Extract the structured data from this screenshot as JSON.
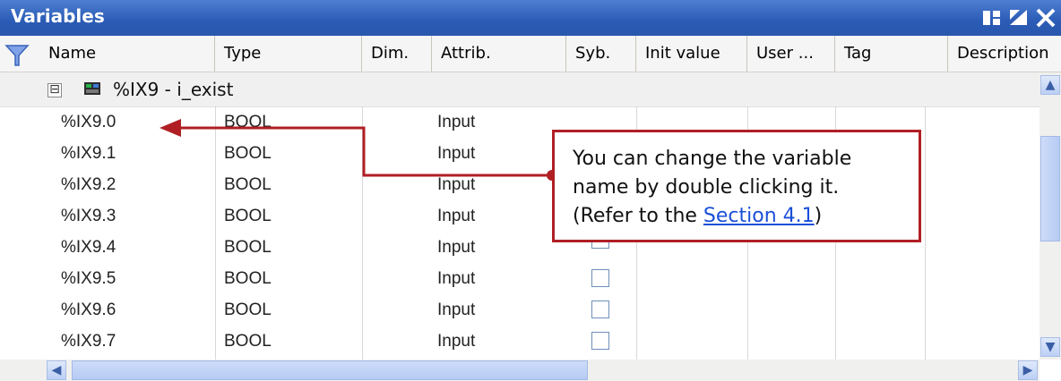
{
  "window": {
    "title": "Variables",
    "buttons": [
      "restore",
      "minimize",
      "close"
    ]
  },
  "columns": [
    "Name",
    "Type",
    "Dim.",
    "Attrib.",
    "Syb.",
    "Init value",
    "User ...",
    "Tag",
    "Description"
  ],
  "group": {
    "label": "%IX9 - i_exist",
    "expanded_symbol": "⊟"
  },
  "rows": [
    {
      "name": "%IX9.0",
      "type": "BOOL",
      "attrib": "Input"
    },
    {
      "name": "%IX9.1",
      "type": "BOOL",
      "attrib": "Input"
    },
    {
      "name": "%IX9.2",
      "type": "BOOL",
      "attrib": "Input"
    },
    {
      "name": "%IX9.3",
      "type": "BOOL",
      "attrib": "Input"
    },
    {
      "name": "%IX9.4",
      "type": "BOOL",
      "attrib": "Input"
    },
    {
      "name": "%IX9.5",
      "type": "BOOL",
      "attrib": "Input"
    },
    {
      "name": "%IX9.6",
      "type": "BOOL",
      "attrib": "Input"
    },
    {
      "name": "%IX9.7",
      "type": "BOOL",
      "attrib": "Input"
    }
  ],
  "callout": {
    "line1": "You can change the variable",
    "line2": "name by double clicking it.",
    "line3_prefix": "(Refer to the ",
    "link": "Section 4.1",
    "line3_suffix": ")"
  },
  "colors": {
    "titlebar": "#2a5bb5",
    "callout_border": "#b01f24",
    "link": "#1a4fd8"
  }
}
